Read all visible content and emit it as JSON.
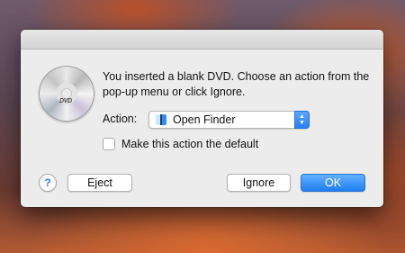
{
  "dialog": {
    "message": "You inserted a blank DVD. Choose an action from the pop-up menu or click Ignore.",
    "disc_icon": "dvd-disc-icon",
    "disc_label": "DVD",
    "action": {
      "label": "Action:",
      "selected": "Open Finder",
      "icon": "finder-icon"
    },
    "checkbox": {
      "label": "Make this action the default",
      "checked": false
    },
    "buttons": {
      "help": "?",
      "eject": "Eject",
      "ignore": "Ignore",
      "ok": "OK"
    },
    "colors": {
      "accent": "#2a7ff4"
    }
  }
}
